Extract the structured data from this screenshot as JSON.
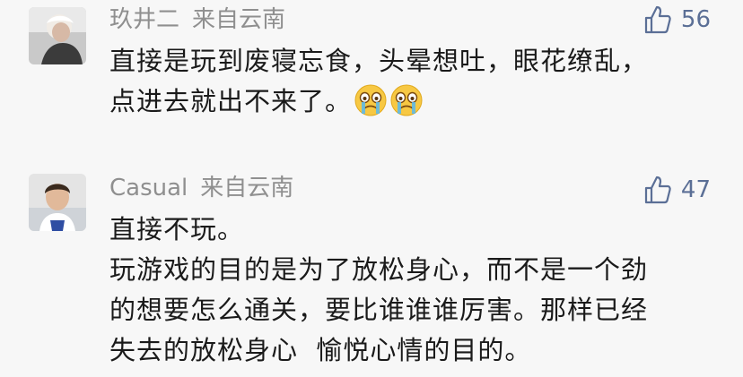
{
  "comments": [
    {
      "username": "玖井二",
      "location": "来自云南",
      "likes": "56",
      "text": "直接是玩到废寝忘食，头晕想吐，眼花缭乱，\n点进去就出不来了。",
      "emojis": [
        "crying-emoji",
        "crying-emoji"
      ]
    },
    {
      "username": "Casual",
      "location": "来自云南",
      "likes": "47",
      "text": "直接不玩。\n玩游戏的目的是为了放松身心，而不是一个劲\n的想要怎么通关，要比谁谁谁厉害。那样已经\n失去的放松身心  愉悦心情的目的。"
    }
  ],
  "icons": {
    "like": "thumbs-up-icon",
    "accent": "#5b6f96"
  }
}
